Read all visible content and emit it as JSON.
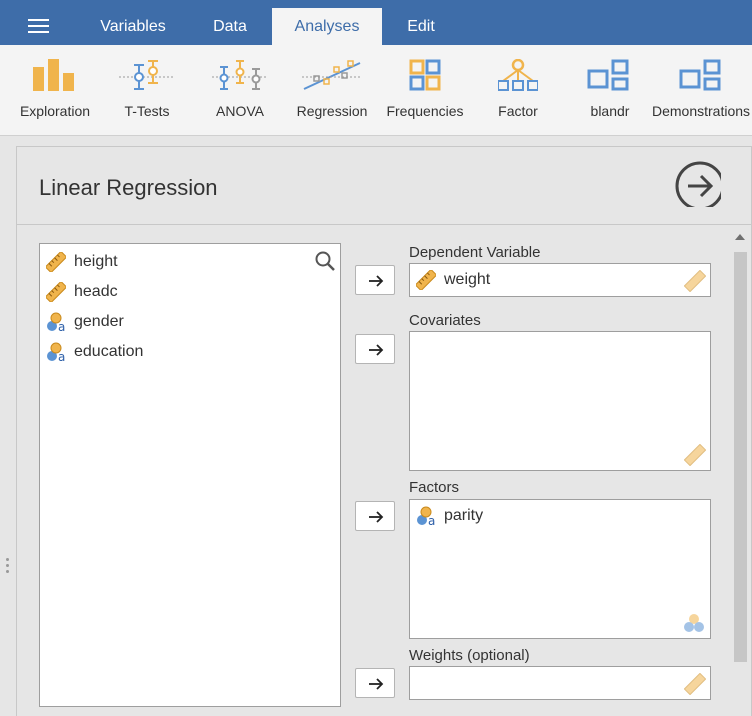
{
  "topbar": {
    "tabs": [
      {
        "label": "Variables"
      },
      {
        "label": "Data"
      },
      {
        "label": "Analyses"
      },
      {
        "label": "Edit"
      }
    ],
    "active_tab": "Analyses"
  },
  "ribbon": {
    "items": [
      {
        "label": "Exploration",
        "icon": "exploration-icon"
      },
      {
        "label": "T-Tests",
        "icon": "t-tests-icon"
      },
      {
        "label": "ANOVA",
        "icon": "anova-icon"
      },
      {
        "label": "Regression",
        "icon": "regression-icon"
      },
      {
        "label": "Frequencies",
        "icon": "frequencies-icon"
      },
      {
        "label": "Factor",
        "icon": "factor-icon"
      },
      {
        "label": "blandr",
        "icon": "module-icon"
      },
      {
        "label": "Demonstrations",
        "icon": "module-icon"
      }
    ]
  },
  "analysis": {
    "title": "Linear Regression",
    "variables": [
      {
        "name": "height",
        "type": "continuous"
      },
      {
        "name": "headc",
        "type": "continuous"
      },
      {
        "name": "gender",
        "type": "nominal"
      },
      {
        "name": "education",
        "type": "nominal"
      }
    ],
    "dependent": {
      "label": "Dependent Variable",
      "value": "weight"
    },
    "covariates": {
      "label": "Covariates"
    },
    "factors": {
      "label": "Factors",
      "items": [
        "parity"
      ]
    },
    "weights": {
      "label": "Weights (optional)"
    }
  },
  "colors": {
    "header": "#3e6da9",
    "ribbon_bg": "#f4f4f4",
    "panel_bg": "#e6e6e6",
    "icon_orange": "#f0b44c",
    "icon_blue": "#5b93d3"
  }
}
